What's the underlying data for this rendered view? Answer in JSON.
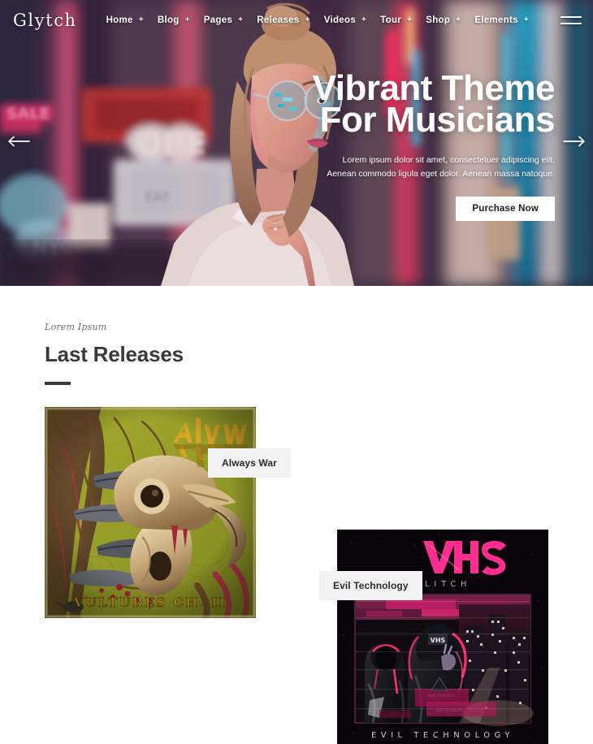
{
  "site": {
    "logo": "Glytch"
  },
  "nav": {
    "items": [
      {
        "label": "Home",
        "has_dropdown": true,
        "indicator": "+"
      },
      {
        "label": "Blog",
        "has_dropdown": true,
        "indicator": "+"
      },
      {
        "label": "Pages",
        "has_dropdown": true,
        "indicator": "+"
      },
      {
        "label": "Releases",
        "has_dropdown": true,
        "indicator": "+"
      },
      {
        "label": "Videos",
        "has_dropdown": true,
        "indicator": "+"
      },
      {
        "label": "Tour",
        "has_dropdown": true,
        "indicator": "+"
      },
      {
        "label": "Shop",
        "has_dropdown": true,
        "indicator": "+"
      },
      {
        "label": "Elements",
        "has_dropdown": true,
        "indicator": "+"
      }
    ],
    "menu_toggle_icon": "hamburger-icon"
  },
  "hero": {
    "title_line1": "Vibrant Theme",
    "title_line2": "For Musicians",
    "description_line1": "Lorem ipsum dolor sit amet, consectetuer adipiscing elit.",
    "description_line2": "Aenean commodo ligula eget dolor. Aenean massa natoque.",
    "cta_label": "Purchase Now",
    "prev_icon": "arrow-left-icon",
    "next_icon": "arrow-right-icon",
    "image_alt": "Woman with sunglasses on neon-lit city street at night"
  },
  "releases": {
    "eyebrow": "Lorem Ipsum",
    "heading": "Last Releases",
    "items": [
      {
        "title": "Always War",
        "art_alt": "Olive green album cover with bird skull illustration",
        "art_artist_mark": "always",
        "art_caption": "VULTURES CH. II"
      },
      {
        "title": "Evil Technology",
        "art_alt": "Dark cyberpunk album cover with neon city",
        "art_artist_mark": "VHS",
        "art_artist_sub": "GLITCH",
        "art_caption": "EVIL TECHNOLOGY"
      }
    ]
  },
  "colors": {
    "page_background": "#ffffff",
    "heading_text": "#3a3a3a",
    "eyebrow_text": "#6d6d6d",
    "label_background": "#f2f2f2",
    "label_text": "#2b2b2b",
    "cta_background": "#ffffff",
    "cta_text": "#1e1e1e",
    "nav_text": "#ffffff",
    "neon_pink": "#e8356d",
    "neon_cyan": "#4fc3d9",
    "album1_background": "#9aa32c",
    "album2_background": "#0a0508",
    "album2_accent": "#ff2d8f"
  }
}
